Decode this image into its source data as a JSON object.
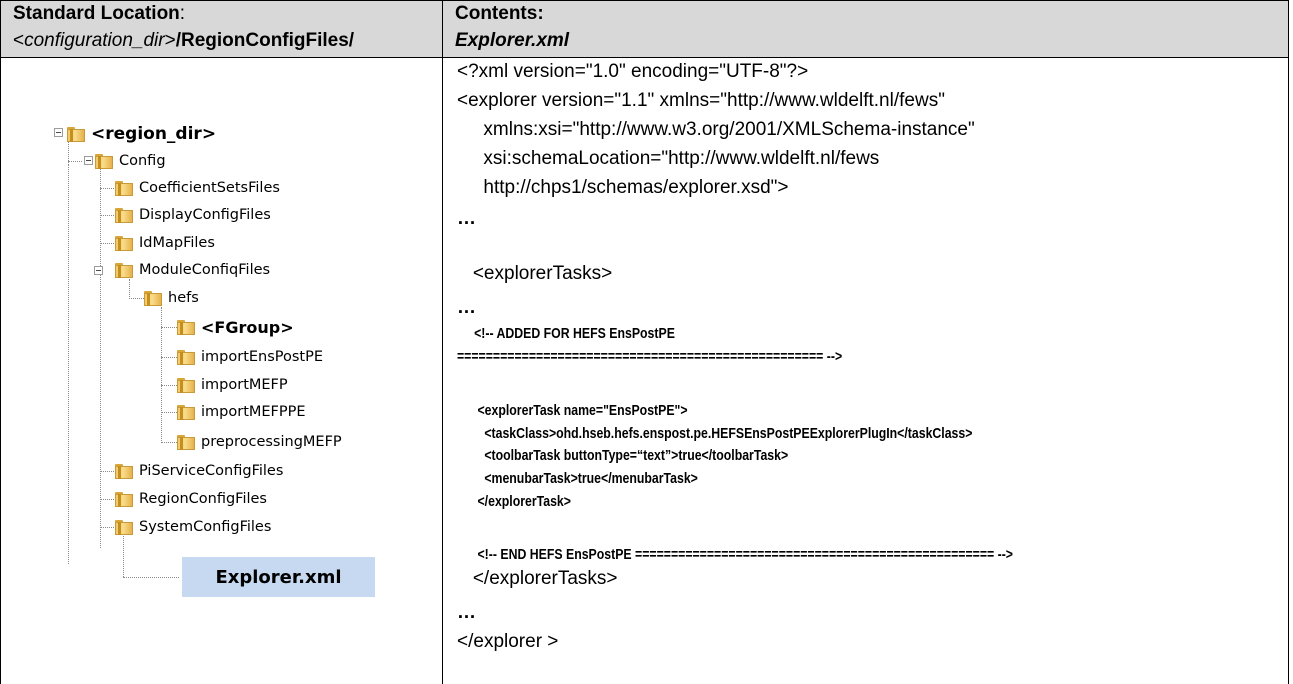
{
  "header": {
    "left_title": "Standard Location",
    "left_colon": ":",
    "left_path_prefix": "<",
    "left_path_var": "configuration_dir",
    "left_path_suffix": ">",
    "left_path_rest": "/RegionConfigFiles/",
    "right_title": "Contents:",
    "right_file": "Explorer.xml"
  },
  "tree": {
    "root": "<region_dir>",
    "config": "Config",
    "children": [
      "CoefficientSetsFiles",
      "DisplayConfigFiles",
      "IdMapFiles",
      "ModuleConfiqFiles"
    ],
    "hefs": "hefs",
    "hefs_children": [
      "<FGroup>",
      "importEnsPostPE",
      "importMEFP",
      "importMEFPPE",
      "preprocessingMEFP"
    ],
    "after": [
      "PiServiceConfigFiles",
      "RegionConfigFiles",
      "SystemConfigFiles"
    ],
    "highlight_file": "Explorer.xml",
    "highlight_color": "#c6d9f1",
    "folder_color": "#f3c969"
  },
  "code": {
    "l1": "<?xml version=\"1.0\" encoding=\"UTF-8\"?>",
    "l2": "<explorer version=\"1.1\" xmlns=\"http://www.wldelft.nl/fews\"",
    "l3": "     xmlns:xsi=\"http://www.w3.org/2001/XMLSchema-instance\"",
    "l4": "     xsi:schemaLocation=\"http://www.wldelft.nl/fews",
    "l5": "     http://chps1/schemas/explorer.xsd\">",
    "l6": "…",
    "l7": "   <explorerTasks>",
    "l8": "…",
    "l9": "     <!-- ADDED FOR HEFS EnsPostPE",
    "l10": "=================================================== -->",
    "l11": "      <explorerTask name=\"EnsPostPE\">",
    "l12": "        <taskClass>ohd.hseb.hefs.enspost.pe.HEFSEnsPostPEExplorerPlugIn</taskClass>",
    "l13": "        <toolbarTask buttonType=“text”>true</toolbarTask>",
    "l14": "        <menubarTask>true</menubarTask>",
    "l15": "      </explorerTask>",
    "l16": "      <!-- END HEFS EnsPostPE ================================================== -->",
    "l17": "   </explorerTasks>",
    "l18": "…",
    "l19": "</explorer >"
  }
}
